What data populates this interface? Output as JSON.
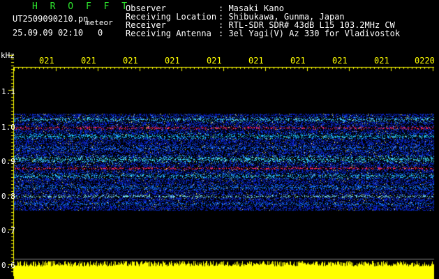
{
  "header": {
    "logo": "H R O F F T",
    "filename": "UT2509090210.pn",
    "mode": "meteor",
    "datetime": "25.09.09 02:10",
    "counter": "0"
  },
  "info": {
    "labels": [
      "Observer",
      "Receiving Location",
      "Receiver",
      "Receiving Antenna"
    ],
    "values": [
      ": Masaki Kano",
      ": Shibukawa, Gunma, Japan",
      ": RTL-SDR SDR# 43dB L15 103.2MHz CW",
      ": 3el Yagi(V) Az 330 for Vladivostok"
    ]
  },
  "axis": {
    "unit": "kHz",
    "y_labels": [
      "1.1",
      "1.0",
      "0.9",
      "0.8",
      "0.7",
      "0.6"
    ],
    "time_labels": [
      "021",
      "021",
      "021",
      "021",
      "021",
      "021",
      "021",
      "021",
      "021",
      "0220"
    ]
  },
  "colors": {
    "background": "#000000",
    "labels": "#ffff00",
    "logo": "#2ee82e",
    "noise_bar": "#ffff00",
    "band_strong": "#ff2060",
    "band_mid": "#30c0ff",
    "band_low": "#1030b0"
  }
}
